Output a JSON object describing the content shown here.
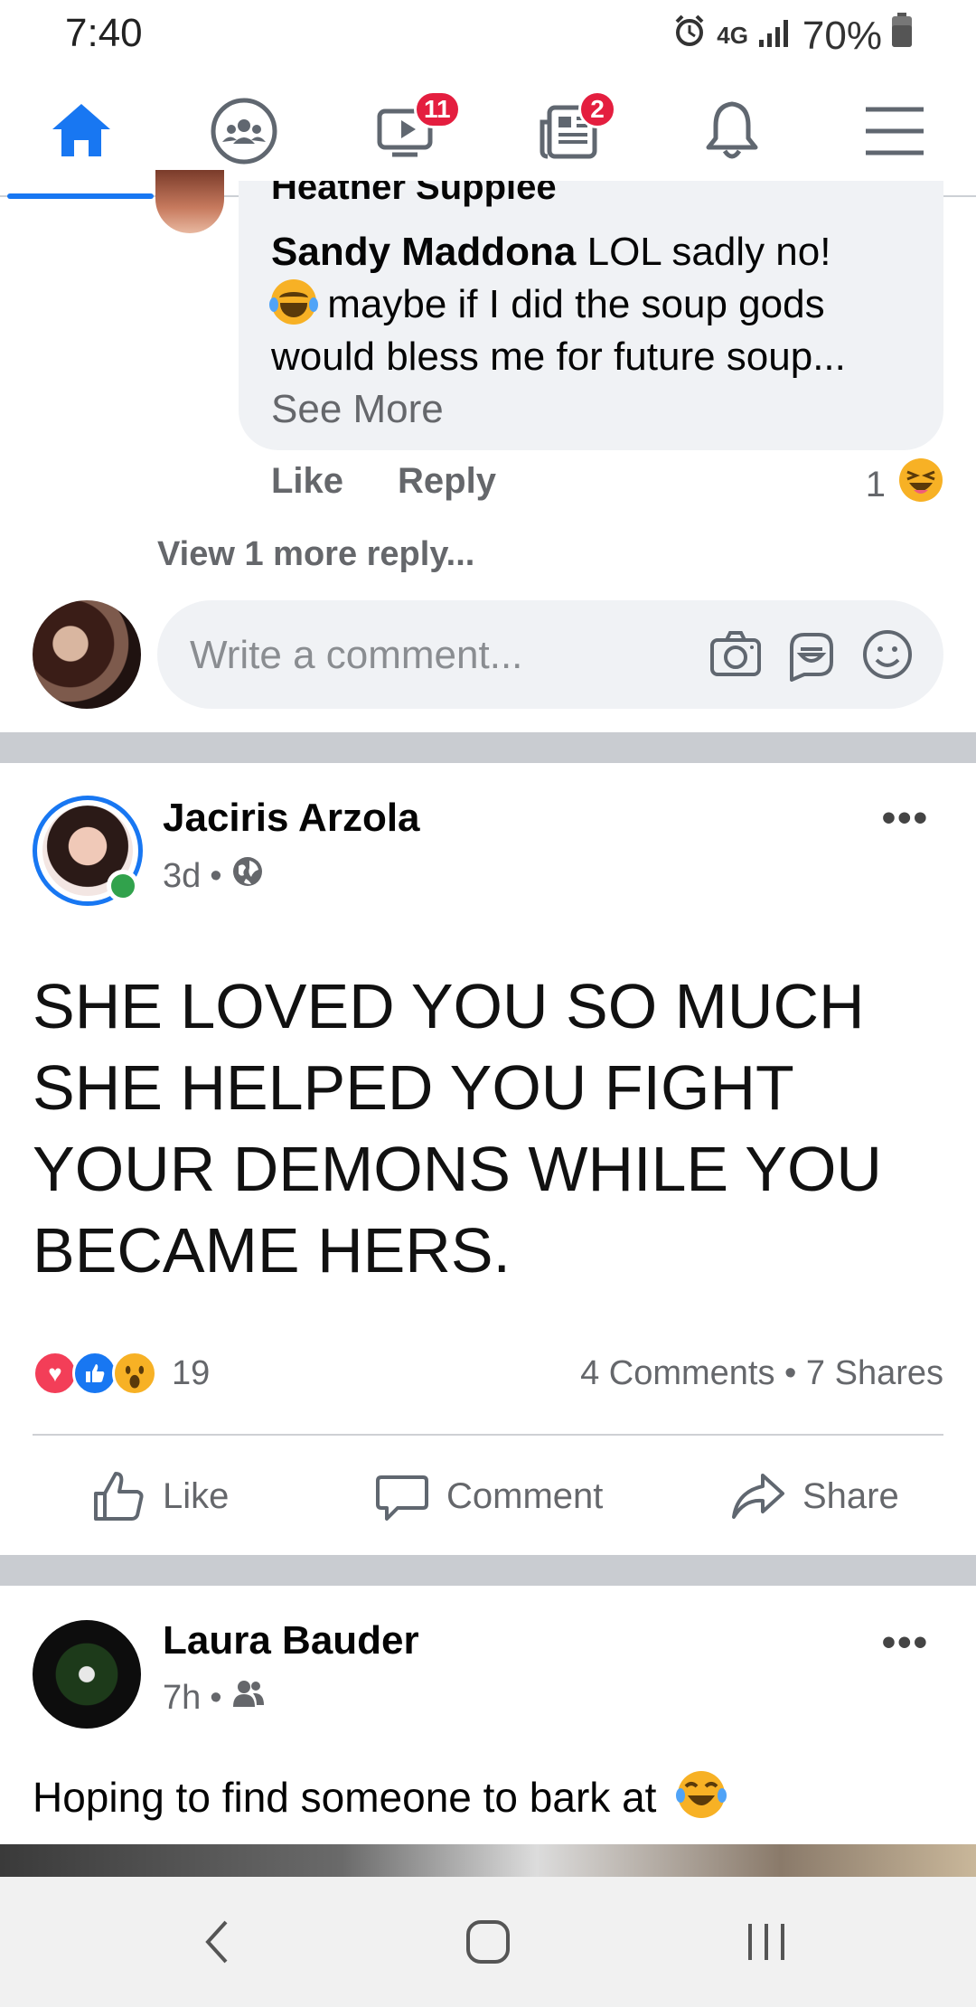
{
  "status_bar": {
    "time": "7:40",
    "network": "4G",
    "battery": "70%"
  },
  "top_nav": {
    "items": [
      "home-icon",
      "groups-icon",
      "watch-icon",
      "news-icon",
      "notifications-icon",
      "menu-icon"
    ],
    "watch_badge": "11",
    "news_badge": "2",
    "active": "home",
    "accent": "#1877f2"
  },
  "comment": {
    "partial_author": "Heather Supplee",
    "author": "Sandy Maddona",
    "text_before_emoji": " LOL sadly no!",
    "text_after_emoji": " maybe if I did the soup gods would bless me for future soup...",
    "see_more": "See More",
    "like": "Like",
    "reply": "Reply",
    "reaction_count": "1",
    "view_more": "View 1 more reply..."
  },
  "write_comment": {
    "placeholder": "Write a comment..."
  },
  "post1": {
    "author": "Jaciris Arzola",
    "time": "3d",
    "text": "SHE LOVED YOU SO MUCH SHE HELPED YOU FIGHT YOUR DEMONS WHILE YOU BECAME HERS.",
    "reaction_count": "19",
    "comments": "4 Comments",
    "shares": "7 Shares",
    "like": "Like",
    "comment": "Comment",
    "share": "Share"
  },
  "post2": {
    "author": "Laura Bauder",
    "time": "7h",
    "text": "Hoping to find someone to bark at"
  }
}
